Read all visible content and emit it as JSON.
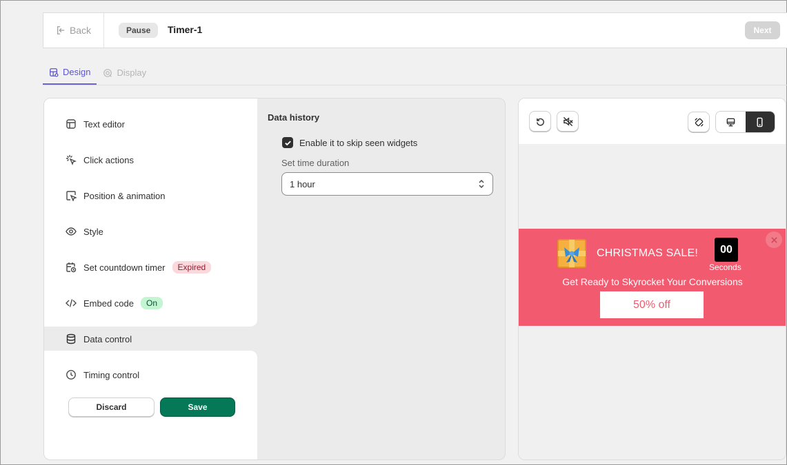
{
  "header": {
    "back_label": "Back",
    "status_label": "Pause",
    "title": "Timer-1",
    "next_label": "Next"
  },
  "tabs": [
    {
      "label": "Design",
      "icon": "design-icon",
      "active": true
    },
    {
      "label": "Display",
      "icon": "display-icon",
      "active": false
    }
  ],
  "sidebar": {
    "items": [
      {
        "label": "Text editor",
        "icon": "text-editor-icon"
      },
      {
        "label": "Click actions",
        "icon": "click-icon"
      },
      {
        "label": "Position & animation",
        "icon": "cursor-icon"
      },
      {
        "label": "Style",
        "icon": "eye-icon"
      },
      {
        "label": "Set countdown timer",
        "icon": "calendar-clock-icon",
        "badge": "Expired"
      },
      {
        "label": "Embed code",
        "icon": "code-icon",
        "badge": "On"
      },
      {
        "label": "Data control",
        "icon": "database-icon",
        "active": true
      },
      {
        "label": "Timing control",
        "icon": "clock-icon"
      }
    ],
    "discard_label": "Discard",
    "save_label": "Save"
  },
  "data_history": {
    "section_title": "Data history",
    "checkbox_label": "Enable it to skip seen widgets",
    "checkbox_checked": true,
    "duration_label": "Set time duration",
    "duration_value": "1 hour"
  },
  "preview": {
    "promo_title": "CHRISTMAS SALE!",
    "countdown_value": "00",
    "countdown_unit": "Seconds",
    "subtitle": "Get Ready to Skyrocket Your Conversions",
    "cta_label": "50% off",
    "colors": {
      "banner": "#f15a6f",
      "accent": "#047857"
    }
  }
}
